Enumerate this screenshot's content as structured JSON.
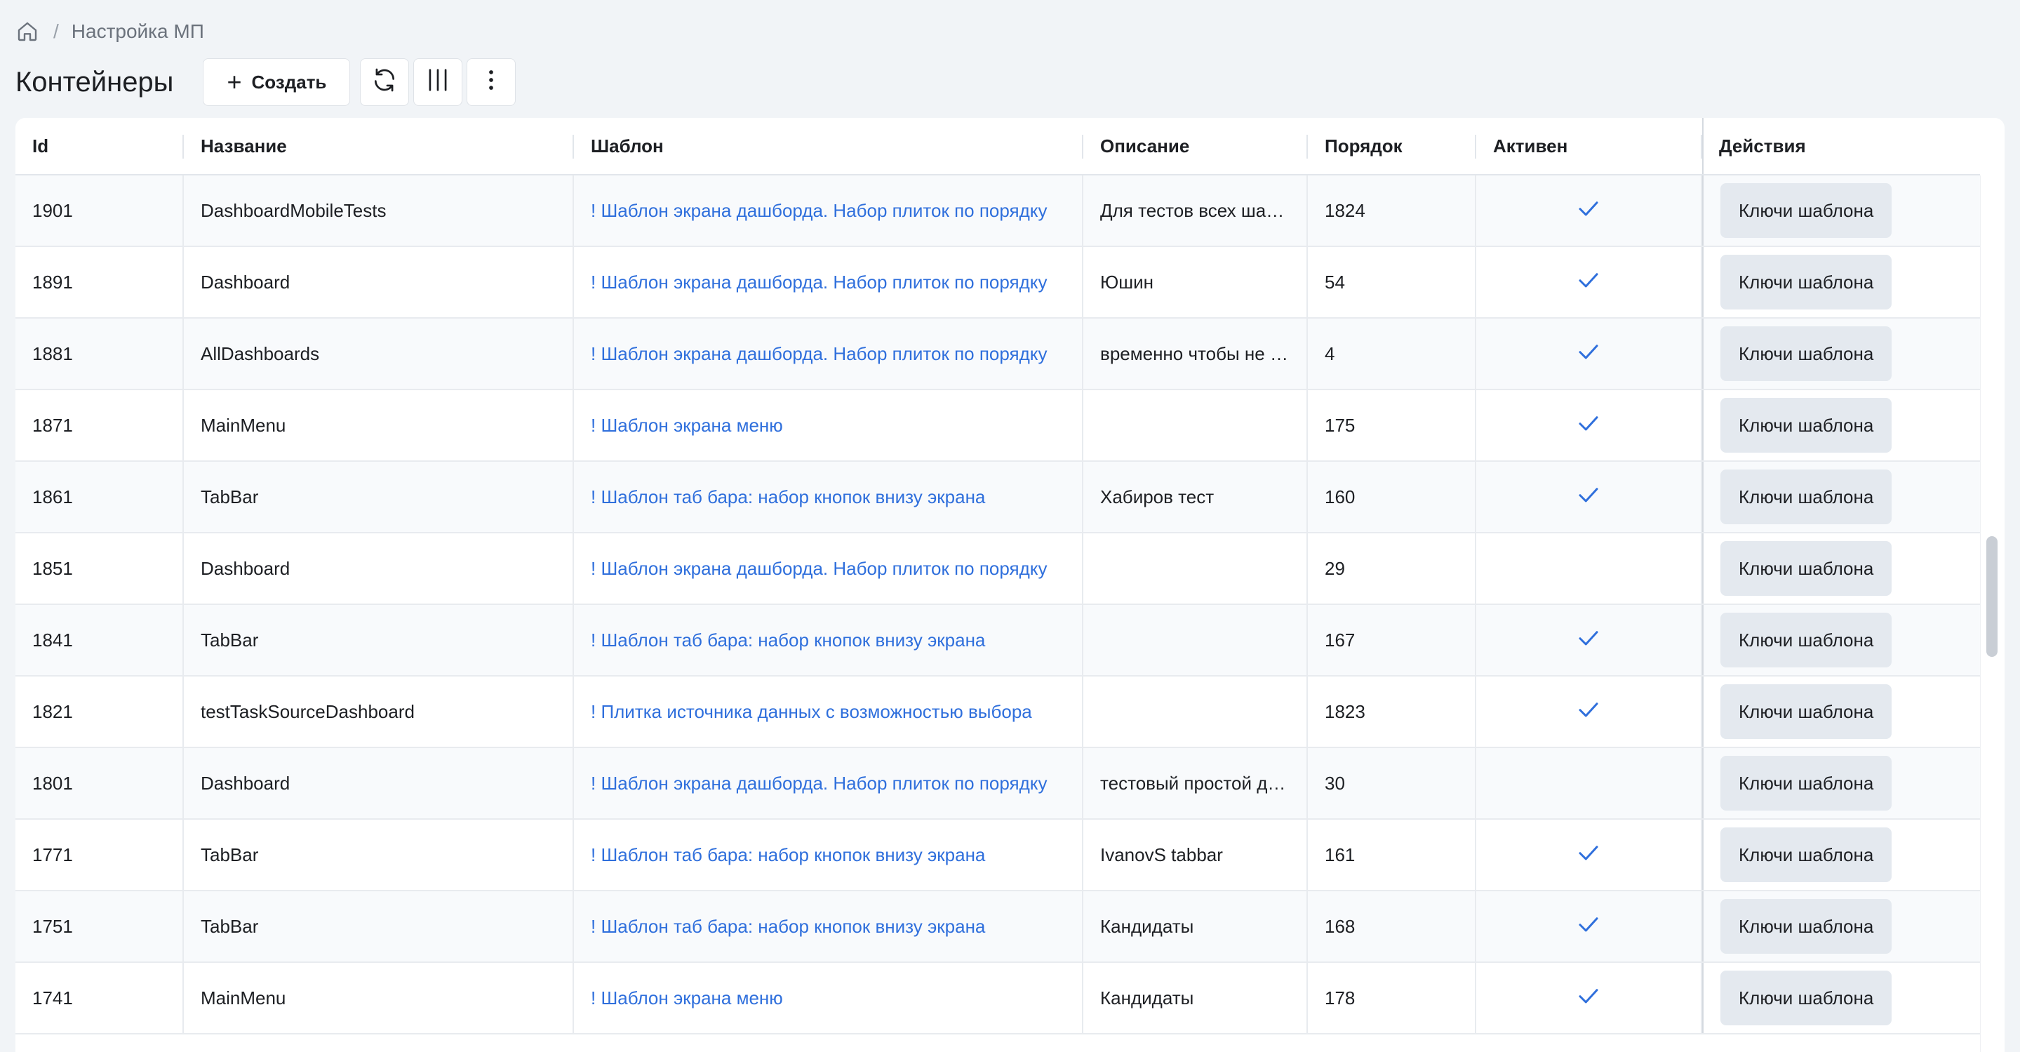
{
  "breadcrumb": {
    "home_icon": "home-icon",
    "separator": "/",
    "current": "Настройка МП"
  },
  "toolbar": {
    "title": "Контейнеры",
    "create_label": "Создать",
    "create_icon": "plus-icon",
    "refresh_icon": "refresh-icon",
    "columns_icon": "columns-icon",
    "more_icon": "more-vertical-icon"
  },
  "table": {
    "headers": {
      "id": "Id",
      "name": "Название",
      "template": "Шаблон",
      "description": "Описание",
      "order": "Порядок",
      "active": "Активен",
      "actions": "Действия"
    },
    "action_label": "Ключи шаблона",
    "active_icon": "checkmark-icon",
    "link_color": "#2f6fdc",
    "check_color": "#2f6fdc",
    "rows": [
      {
        "id": "1901",
        "name": "DashboardMobileTests",
        "template": "! Шаблон экрана дашборда. Набор плиток по порядку",
        "description": "Для тестов всех шаблонов",
        "order": "1824",
        "active": true
      },
      {
        "id": "1891",
        "name": "Dashboard",
        "template": "! Шаблон экрана дашборда. Набор плиток по порядку",
        "description": "Юшин",
        "order": "54",
        "active": true
      },
      {
        "id": "1881",
        "name": "AllDashboards",
        "template": "! Шаблон экрана дашборда. Набор плиток по порядку",
        "description": "временно чтобы не падало",
        "order": "4",
        "active": true
      },
      {
        "id": "1871",
        "name": "MainMenu",
        "template": "! Шаблон экрана меню",
        "description": "",
        "order": "175",
        "active": true
      },
      {
        "id": "1861",
        "name": "TabBar",
        "template": "! Шаблон таб бара: набор кнопок внизу экрана",
        "description": "Хабиров тест",
        "order": "160",
        "active": true
      },
      {
        "id": "1851",
        "name": "Dashboard",
        "template": "! Шаблон экрана дашборда. Набор плиток по порядку",
        "description": "",
        "order": "29",
        "active": false
      },
      {
        "id": "1841",
        "name": "TabBar",
        "template": "! Шаблон таб бара: набор кнопок внизу экрана",
        "description": "",
        "order": "167",
        "active": true
      },
      {
        "id": "1821",
        "name": "testTaskSourceDashboard",
        "template": "! Плитка источника данных с возможностью выбора",
        "description": "",
        "order": "1823",
        "active": true
      },
      {
        "id": "1801",
        "name": "Dashboard",
        "template": "! Шаблон экрана дашборда. Набор плиток по порядку",
        "description": "тестовый простой дашборд",
        "order": "30",
        "active": false
      },
      {
        "id": "1771",
        "name": "TabBar",
        "template": "! Шаблон таб бара: набор кнопок внизу экрана",
        "description": "IvanovS tabbar",
        "order": "161",
        "active": true
      },
      {
        "id": "1751",
        "name": "TabBar",
        "template": "! Шаблон таб бара: набор кнопок внизу экрана",
        "description": "Кандидаты",
        "order": "168",
        "active": true
      },
      {
        "id": "1741",
        "name": "MainMenu",
        "template": "! Шаблон экрана меню",
        "description": "Кандидаты",
        "order": "178",
        "active": true
      }
    ]
  }
}
